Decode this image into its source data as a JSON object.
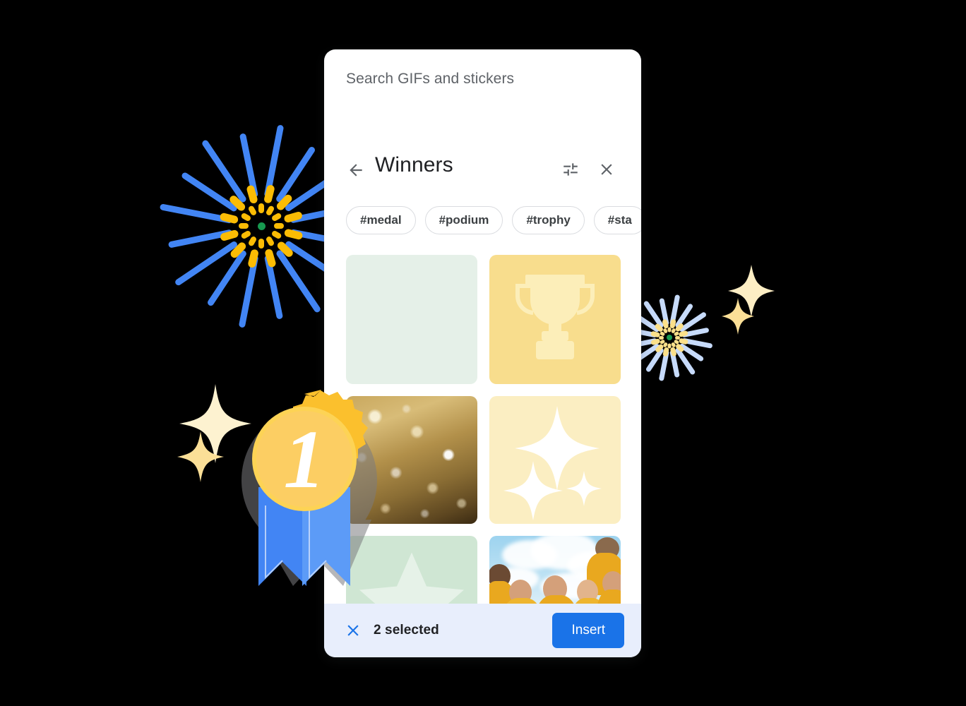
{
  "card": {
    "search_label": "Search GIFs and stickers",
    "title": "Winners",
    "icons": {
      "back": "arrow-left-icon",
      "tune": "tune-icon",
      "close": "close-icon"
    },
    "chips": [
      {
        "label": "#medal"
      },
      {
        "label": "#podium"
      },
      {
        "label": "#trophy"
      },
      {
        "label": "#sta"
      }
    ],
    "grid": [
      {
        "name": "tile-blank-mint",
        "kind": "solid",
        "color": "#e5f0e8",
        "selected": false
      },
      {
        "name": "tile-trophy",
        "kind": "trophy",
        "color": "#f8dd8d",
        "selected": false
      },
      {
        "name": "tile-gold-glitter",
        "kind": "glitter",
        "color": "#b2904a",
        "selected": true
      },
      {
        "name": "tile-sparkles",
        "kind": "sparkles",
        "color": "#fbeec2",
        "selected": false
      },
      {
        "name": "tile-star",
        "kind": "star",
        "color": "#cfe6d3",
        "selected": false
      },
      {
        "name": "tile-people-photo",
        "kind": "photo",
        "color": "#9dd3ef",
        "selected": true
      }
    ],
    "footer": {
      "close_icon": "close-icon",
      "selected_text": "2 selected",
      "insert_label": "Insert"
    }
  },
  "decorations": [
    {
      "name": "firework-blue-large",
      "ray_color": "#4285f4",
      "inner_color": "#fbbc04",
      "core_color": "#17994f"
    },
    {
      "name": "firework-blue-small",
      "ray_color": "#c7dbfb",
      "inner_color": "#fbe08a",
      "core_color": "#17994f"
    },
    {
      "name": "sparkle-cream-large",
      "color": "#fdf2d0"
    },
    {
      "name": "sparkle-cream-small",
      "color": "#fbdf97"
    },
    {
      "name": "sparkle-right-large",
      "color": "#fdeec4"
    },
    {
      "name": "sparkle-right-small",
      "color": "#fbdf97"
    },
    {
      "name": "award-medal-ribbon",
      "medal_color": "#fbc02d",
      "ribbon_color": "#4285f4",
      "number": "1"
    }
  ],
  "colors": {
    "accent_blue": "#1a73e8",
    "footer_bg": "#e8eefc",
    "card_bg": "#ffffff",
    "page_bg": "#000000",
    "text_primary": "#202124",
    "text_secondary": "#5f6368"
  }
}
